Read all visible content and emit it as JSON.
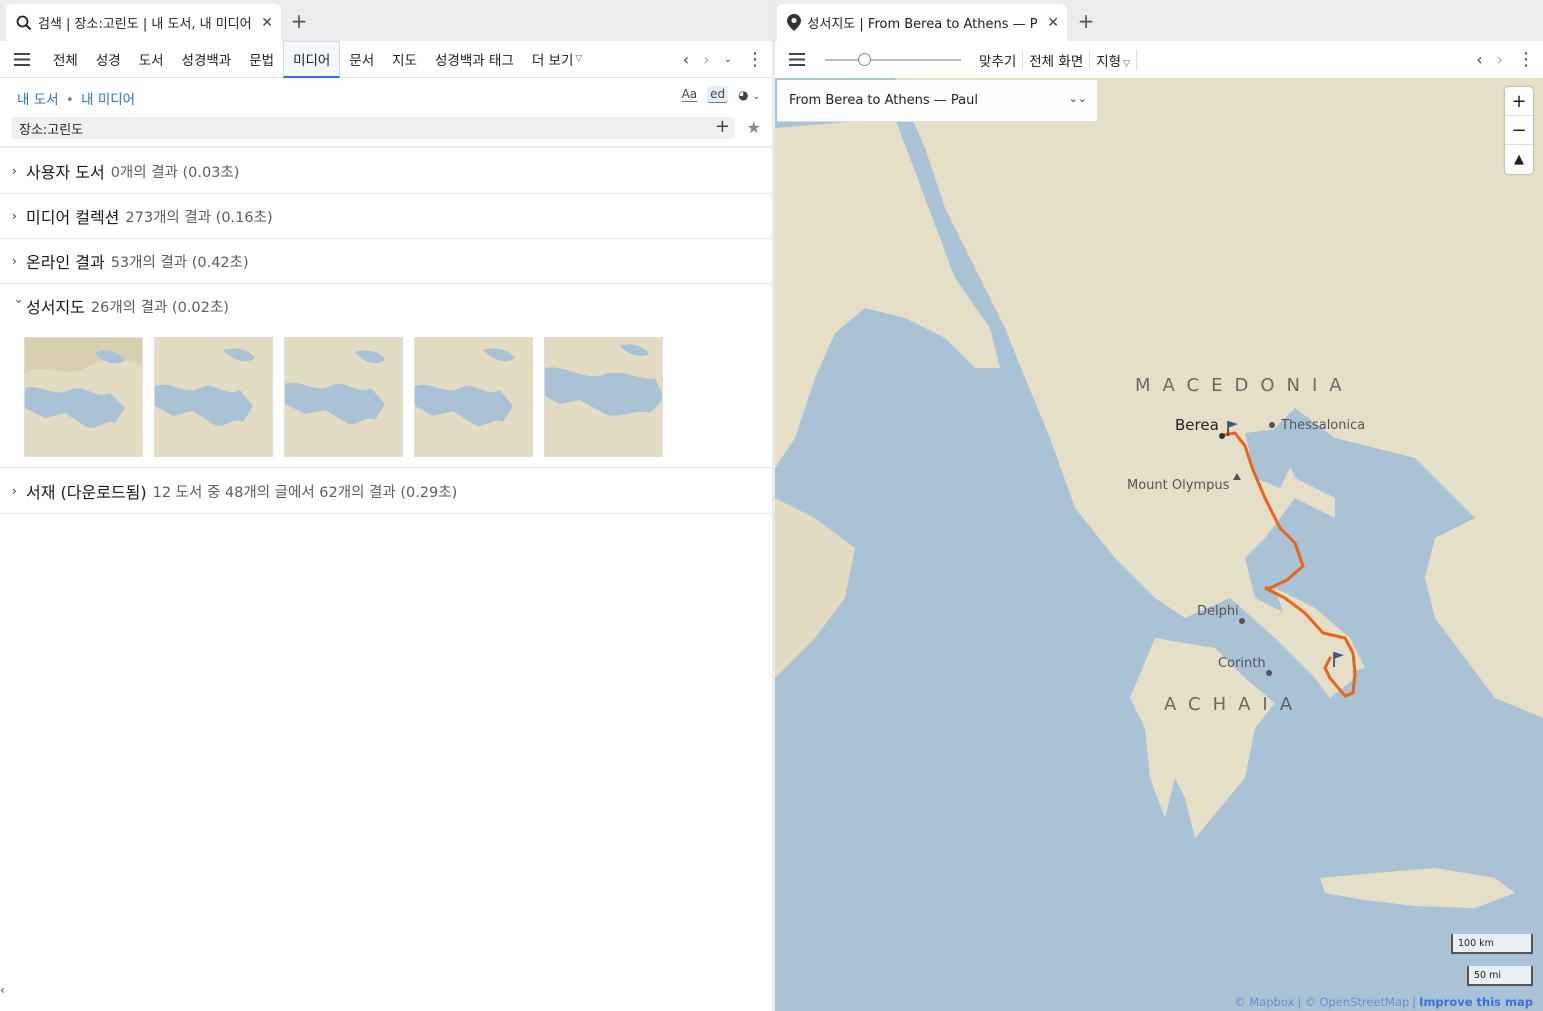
{
  "left": {
    "tab_title": "검색 | 장소:고린도 | 내 도서, 내 미디어",
    "nav_tabs": [
      "전체",
      "성경",
      "도서",
      "성경백과",
      "문법",
      "미디어",
      "문서",
      "지도",
      "성경백과 태그",
      "더 보기"
    ],
    "active_tab": "미디어",
    "scope": {
      "my_books": "내 도서",
      "separator": "•",
      "my_media": "내 미디어"
    },
    "view_icons": {
      "font": "Aa",
      "ed": "ed"
    },
    "search_query": "장소:고린도",
    "results": [
      {
        "title": "사용자 도서",
        "count": "0개의 결과 (0.03초)",
        "expanded": false
      },
      {
        "title": "미디어 컬렉션",
        "count": "273개의 결과 (0.16초)",
        "expanded": false
      },
      {
        "title": "온라인 결과",
        "count": "53개의 결과 (0.42초)",
        "expanded": false
      },
      {
        "title": "성서지도",
        "count": "26개의 결과 (0.02초)",
        "expanded": true
      },
      {
        "title": "서재 (다운로드됨)",
        "count": "12 도서 중 48개의 글에서 62개의 결과 (0.29초)",
        "expanded": false
      }
    ]
  },
  "right": {
    "tab_title": "성서지도 | From Berea to Athens — Paul",
    "toolbar": {
      "fit": "맞추기",
      "fullscreen": "전체 화면",
      "terrain": "지형"
    },
    "zoom_slider_fraction": 0.27,
    "map_title": "From Berea to Athens — Paul",
    "labels": {
      "macedonia": "MACEDONIA",
      "achaia": "ACHAIA",
      "berea": "Berea",
      "thessalonica": "Thessalonica",
      "olympus": "Mount Olympus",
      "delphi": "Delphi",
      "corinth": "Corinth"
    },
    "scale_km": "100 km",
    "scale_mi": "50 mi",
    "attribution": {
      "mapbox": "© Mapbox",
      "osm": "© OpenStreetMap",
      "improve": "Improve this map"
    },
    "colors": {
      "sea": "#a9c2d6",
      "land": "#e6dfc8",
      "route": "#e8651a"
    }
  }
}
